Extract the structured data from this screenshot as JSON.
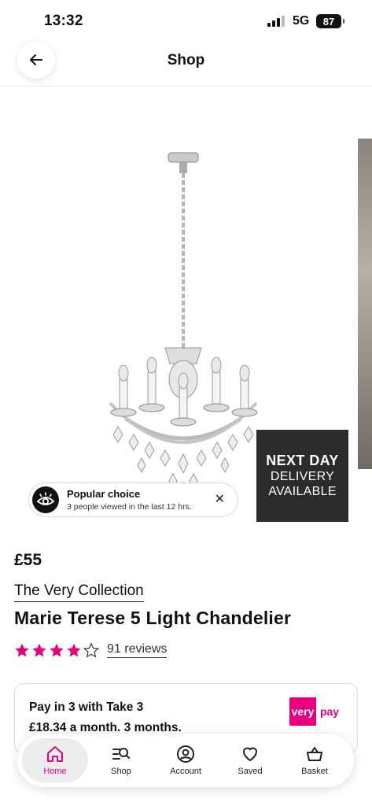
{
  "status": {
    "time": "13:32",
    "network": "5G",
    "battery": "87"
  },
  "header": {
    "title": "Shop"
  },
  "gallery": {
    "delivery_badge": {
      "line1": "NEXT DAY",
      "line2": "DELIVERY",
      "line3": "AVAILABLE"
    },
    "popular": {
      "title": "Popular choice",
      "subtitle": "3 people viewed in the last 12 hrs."
    }
  },
  "product": {
    "price": "£55",
    "brand": "The Very Collection",
    "title": "Marie Terese 5 Light Chandelier",
    "rating": 4,
    "rating_max": 5,
    "reviews": "91 reviews"
  },
  "pay": {
    "line1": "Pay in 3 with Take 3",
    "line2": "£18.34 a month. 3 months.",
    "logo_left": "very",
    "logo_right": "pay"
  },
  "nav": {
    "items": [
      {
        "label": "Home",
        "icon": "home-icon",
        "active": true
      },
      {
        "label": "Shop",
        "icon": "shop-search-icon",
        "active": false
      },
      {
        "label": "Account",
        "icon": "account-icon",
        "active": false
      },
      {
        "label": "Saved",
        "icon": "heart-icon",
        "active": false
      },
      {
        "label": "Basket",
        "icon": "basket-icon",
        "active": false
      }
    ]
  },
  "colors": {
    "accent": "#e6007e",
    "badge_bg": "#2b2b2b"
  }
}
